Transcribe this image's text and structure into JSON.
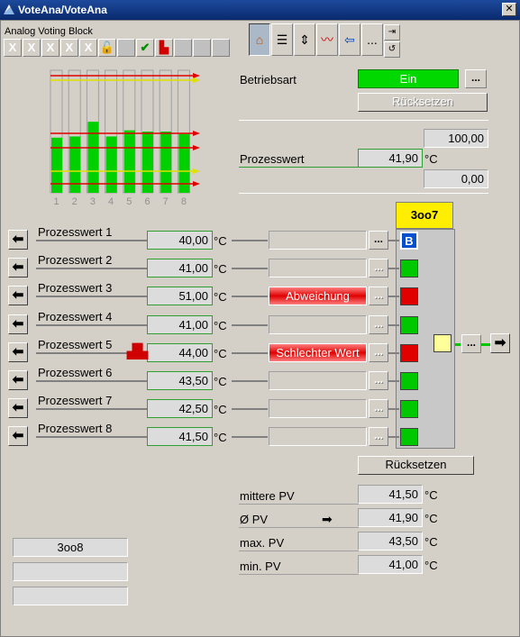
{
  "window": {
    "title": "VoteAna/VoteAna",
    "close": "✕"
  },
  "block_label": "Analog Voting Block",
  "toolbar": {
    "small_buttons": [
      "X",
      "X",
      "X",
      "X",
      "X"
    ],
    "more_label": "..."
  },
  "bars": {
    "x_labels": [
      "1",
      "2",
      "3",
      "4",
      "5",
      "6",
      "7",
      "8"
    ],
    "levels": [
      0.45,
      0.46,
      0.58,
      0.46,
      0.51,
      0.5,
      0.5,
      0.48
    ],
    "colors": {
      "fill": "#00d000",
      "limit_high": "#e00000",
      "limit_warn": "#e0e000",
      "frame": "#a0a0a0"
    }
  },
  "mode": {
    "label": "Betriebsart",
    "value": "Ein",
    "more": "...",
    "reset": "Rücksetzen"
  },
  "process": {
    "label": "Prozesswert",
    "value": "41,90",
    "unit": "°C",
    "high": "100,00",
    "low": "0,00"
  },
  "inputs": [
    {
      "label": "Prozesswert 1",
      "value": "40,00",
      "unit": "°C",
      "status": "",
      "state": "B",
      "more": "..."
    },
    {
      "label": "Prozesswert 2",
      "value": "41,00",
      "unit": "°C",
      "status": "",
      "state": "green",
      "more": "..."
    },
    {
      "label": "Prozesswert 3",
      "value": "51,00",
      "unit": "°C",
      "status": "Abweichung",
      "state": "red",
      "more": "..."
    },
    {
      "label": "Prozesswert 4",
      "value": "41,00",
      "unit": "°C",
      "status": "",
      "state": "green",
      "more": "..."
    },
    {
      "label": "Prozesswert 5",
      "value": "44,00",
      "unit": "°C",
      "status": "Schlechter Wert",
      "state": "red",
      "more": "..."
    },
    {
      "label": "Prozesswert 6",
      "value": "43,50",
      "unit": "°C",
      "status": "",
      "state": "green",
      "more": "..."
    },
    {
      "label": "Prozesswert 7",
      "value": "42,50",
      "unit": "°C",
      "status": "",
      "state": "green",
      "more": "..."
    },
    {
      "label": "Prozesswert 8",
      "value": "41,50",
      "unit": "°C",
      "status": "",
      "state": "green",
      "more": "..."
    }
  ],
  "voting": {
    "label": "3oo7",
    "output_more": "...",
    "reset": "Rücksetzen"
  },
  "stats": [
    {
      "label": "mittere PV",
      "value": "41,50",
      "unit": "°C"
    },
    {
      "label": "Ø PV",
      "value": "41,90",
      "unit": "°C"
    },
    {
      "label": "max. PV",
      "value": "43,50",
      "unit": "°C"
    },
    {
      "label": "min. PV",
      "value": "41,00",
      "unit": "°C"
    }
  ],
  "info_box": {
    "line1": "3oo8",
    "line2": "",
    "line3": ""
  },
  "colors": {
    "ok": "#00c800",
    "alarm": "#e00000",
    "bypass": "#0050d0",
    "vote": "#ffee00",
    "output": "#ffff99"
  }
}
